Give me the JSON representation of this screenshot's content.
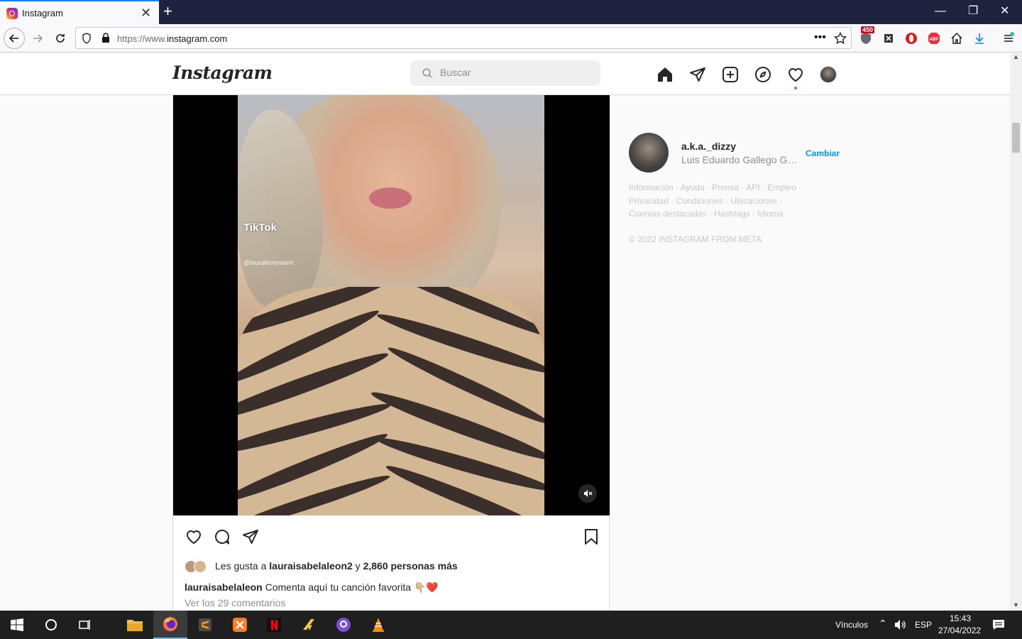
{
  "browser": {
    "tab_title": "Instagram",
    "tab_close": "✕",
    "new_tab": "+",
    "url_prefix": "https://www.",
    "url_domain": "instagram.com",
    "badge_count": "450",
    "window_controls": {
      "minimize": "—",
      "restore": "❐",
      "close": "✕"
    }
  },
  "instagram": {
    "logo": "Instagram",
    "search_placeholder": "Buscar",
    "nav_icons": [
      "home-icon",
      "direct-icon",
      "new-post-icon",
      "explore-icon",
      "activity-icon",
      "profile-avatar"
    ]
  },
  "post": {
    "tiktok_label": "TikTok",
    "tiktok_handle": "@lauraleonmiami",
    "likes_prefix": "Les gusta a ",
    "likes_user": "lauraisabelaleon2",
    "likes_middle": " y ",
    "likes_count": "2,860 personas más",
    "caption_user": "lauraisabelaleon",
    "caption_text": "Comenta aquí tu canción favorita 👇🏼❤️",
    "comments_link": "Ver los 29 comentarios"
  },
  "sidebar": {
    "username": "a.k.a._dizzy",
    "full_name": "Luis Eduardo Gallego Gar...",
    "switch_label": "Cambiar",
    "footer_line1": "Información · Ayuda · Prensa · API · Empleo ·",
    "footer_line2": "Privacidad · Condiciones · Ubicaciones ·",
    "footer_line3": "Cuentas destacadas · Hashtags · Idioma",
    "copyright": "© 2022 INSTAGRAM FROM META"
  },
  "taskbar": {
    "vinculos": "Vínculos",
    "language": "ESP",
    "time": "15:43",
    "date": "27/04/2022"
  }
}
